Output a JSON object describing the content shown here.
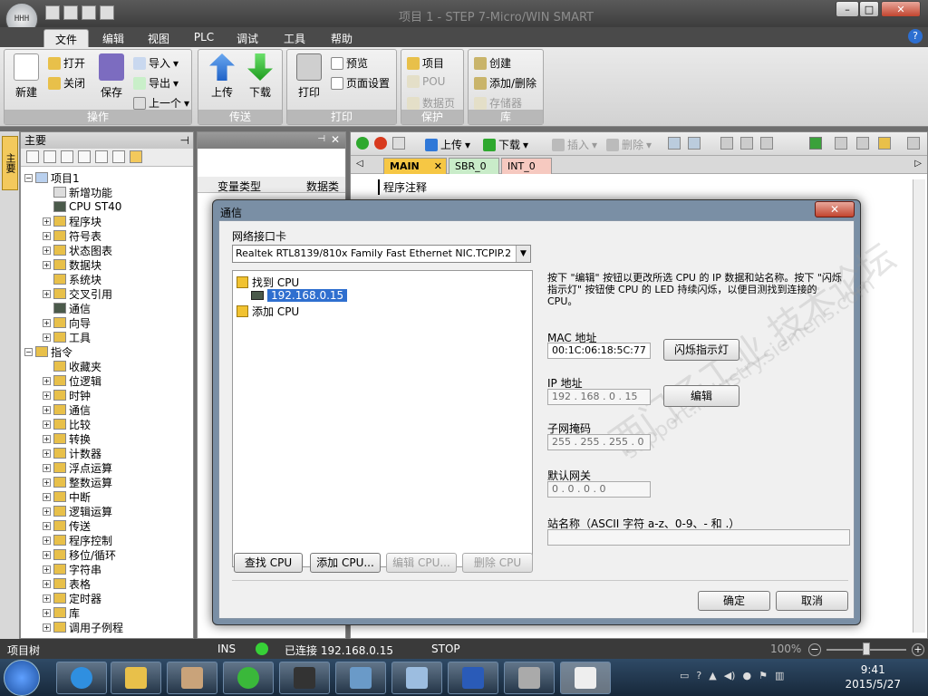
{
  "window": {
    "title": "项目 1 - STEP 7-Micro/WIN SMART",
    "orb_text": "HHH"
  },
  "menu": {
    "tabs": [
      "文件",
      "编辑",
      "视图",
      "PLC",
      "调试",
      "工具",
      "帮助"
    ],
    "active": "文件"
  },
  "ribbon": {
    "groups": {
      "operate": "操作",
      "transfer": "传送",
      "print": "打印",
      "protect": "保护",
      "library": "库"
    },
    "new": "新建",
    "open": "打开",
    "close": "关闭",
    "save": "保存",
    "import": "导入",
    "export": "导出",
    "previous": "上一个",
    "upload": "上传",
    "download": "下载",
    "print": "打印",
    "preview": "预览",
    "page_setup": "页面设置",
    "project": "项目",
    "pou": "POU",
    "data_page": "数据页",
    "create": "创建",
    "add_delete": "添加/删除",
    "memory": "存储器"
  },
  "nav": {
    "header": "主要",
    "side_tab": "主要",
    "tree": [
      "项目1",
      "新增功能",
      "CPU ST40",
      "程序块",
      "符号表",
      "状态图表",
      "数据块",
      "系统块",
      "交叉引用",
      "通信",
      "向导",
      "工具",
      "指令",
      "收藏夹",
      "位逻辑",
      "时钟",
      "通信",
      "比较",
      "转换",
      "计数器",
      "浮点运算",
      "整数运算",
      "中断",
      "逻辑运算",
      "传送",
      "程序控制",
      "移位/循环",
      "字符串",
      "表格",
      "定时器",
      "库",
      "调用子例程"
    ]
  },
  "middle": {
    "col_type": "变量类型",
    "col_data": "数据类"
  },
  "editor": {
    "toolbar_upload": "上传",
    "toolbar_download": "下载",
    "toolbar_insert": "插入",
    "toolbar_delete": "删除",
    "tabs": [
      "MAIN",
      "SBR_0",
      "INT_0"
    ],
    "comment": "程序注释"
  },
  "dialog": {
    "title": "通信",
    "nic_label": "网络接口卡",
    "nic_value": "Realtek RTL8139/810x Family Fast Ethernet NIC.TCPIP.2",
    "tree_found": "找到 CPU",
    "tree_ip": "192.168.0.15",
    "tree_add": "添加 CPU",
    "description": "按下 \"编辑\" 按钮以更改所选 CPU 的 IP 数据和站名称。按下 \"闪烁指示灯\" 按钮使 CPU 的 LED 持续闪烁，以便目测找到连接的 CPU。",
    "mac_label": "MAC 地址",
    "mac_value": "00:1C:06:18:5C:77",
    "blink_button": "闪烁指示灯",
    "ip_label": "IP 地址",
    "ip_value": "192 . 168 . 0 . 15",
    "edit_button": "编辑",
    "subnet_label": "子网掩码",
    "subnet_value": "255 . 255 . 255 . 0",
    "gateway_label": "默认网关",
    "gateway_value": "0 . 0 . 0 . 0",
    "station_label": "站名称（ASCII 字符 a-z、0-9、- 和 .）",
    "station_value": "",
    "find_cpu": "查找 CPU",
    "add_cpu": "添加 CPU...",
    "edit_cpu": "编辑 CPU...",
    "delete_cpu": "删除 CPU",
    "ok": "确定",
    "cancel": "取消",
    "watermark1": "西门子工业  技术论坛",
    "watermark2": "support.industry.siemens.com"
  },
  "status": {
    "tree": "项目树",
    "ins": "INS",
    "connected": "已连接 192.168.0.15",
    "stop": "STOP",
    "zoom": "100%"
  },
  "taskbar": {
    "time": "9:41",
    "date": "2015/5/27"
  }
}
